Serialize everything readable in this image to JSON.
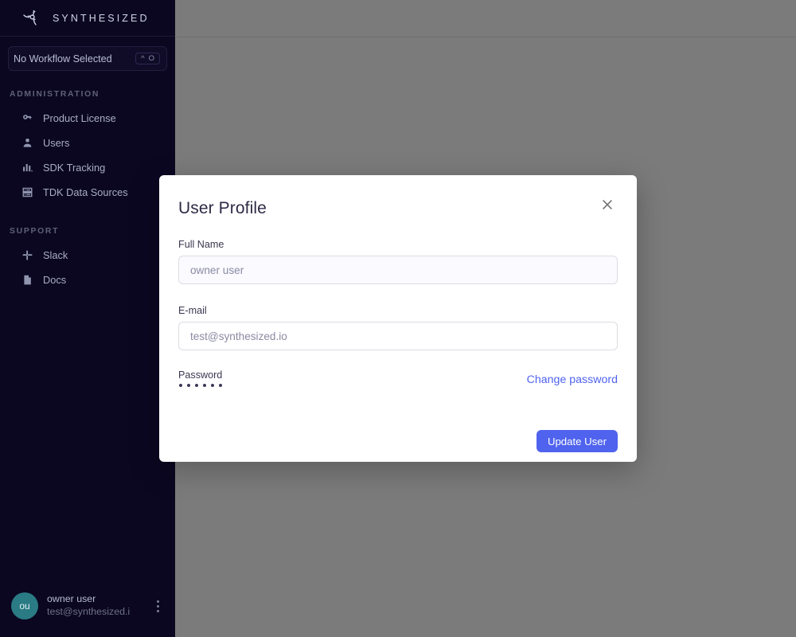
{
  "sidebar": {
    "brand": {
      "name": "SYNTHESIZED",
      "logo_icon": "synthesized-logo-icon"
    },
    "workflow": {
      "label": "No Workflow Selected",
      "shortcut_modifier": "^",
      "shortcut_key": "O"
    },
    "sections": [
      {
        "title": "ADMINISTRATION",
        "items": [
          {
            "label": "Product License",
            "icon": "key-icon"
          },
          {
            "label": "Users",
            "icon": "person-icon"
          },
          {
            "label": "SDK Tracking",
            "icon": "bar-chart-icon"
          },
          {
            "label": "TDK Data Sources",
            "icon": "server-icon"
          }
        ]
      },
      {
        "title": "SUPPORT",
        "items": [
          {
            "label": "Slack",
            "icon": "slack-icon"
          },
          {
            "label": "Docs",
            "icon": "document-icon"
          }
        ]
      }
    ],
    "footer": {
      "avatar_initials": "ou",
      "user_name": "owner user",
      "user_email": "test@synthesized.i",
      "menu_icon": "vertical-dots-icon"
    }
  },
  "modal": {
    "title": "User Profile",
    "close_icon": "close-icon",
    "fields": [
      {
        "label": "Full Name",
        "value": "",
        "placeholder": "owner user"
      },
      {
        "label": "E-mail",
        "value": "",
        "placeholder": "test@synthesized.io"
      }
    ],
    "password": {
      "label": "Password",
      "masked_value": "••••••",
      "dot_count": 6,
      "change_link": "Change password"
    },
    "submit_label": "Update User"
  },
  "colors": {
    "sidebar_bg": "#0b0721",
    "backdrop": "#7b7b7b",
    "accent": "#4f63ee",
    "avatar_bg": "#2a7b84"
  }
}
